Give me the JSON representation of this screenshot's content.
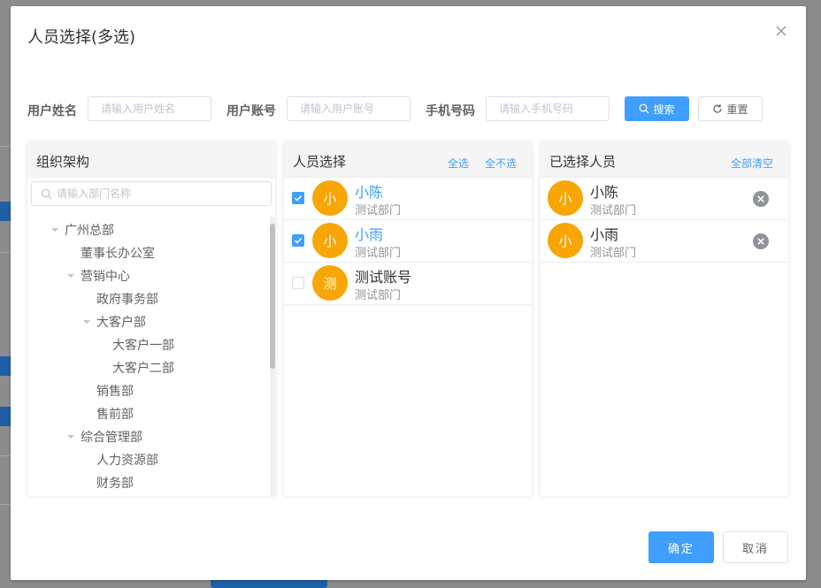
{
  "dialog": {
    "title": "人员选择(多选)"
  },
  "search": {
    "name_label": "用户姓名",
    "name_placeholder": "请输入用户姓名",
    "account_label": "用户账号",
    "account_placeholder": "请输入用户账号",
    "phone_label": "手机号码",
    "phone_placeholder": "请输入手机号码",
    "search_button": "搜索",
    "reset_button": "重置"
  },
  "org_panel": {
    "title": "组织架构",
    "search_placeholder": "请输入部门名称",
    "tree": [
      {
        "label": "广州总部",
        "expanded": true
      },
      {
        "label": "董事长办公室"
      },
      {
        "label": "营销中心",
        "expanded": true
      },
      {
        "label": "政府事务部"
      },
      {
        "label": "大客户部",
        "expanded": true
      },
      {
        "label": "大客户一部"
      },
      {
        "label": "大客户二部"
      },
      {
        "label": "销售部"
      },
      {
        "label": "售前部"
      },
      {
        "label": "综合管理部",
        "expanded": true
      },
      {
        "label": "人力资源部"
      },
      {
        "label": "财务部"
      }
    ]
  },
  "user_panel": {
    "title": "人员选择",
    "select_all": "全选",
    "deselect_all": "全不选",
    "users": [
      {
        "avatar": "小",
        "name": "小陈",
        "dept": "测试部门",
        "checked": true
      },
      {
        "avatar": "小",
        "name": "小雨",
        "dept": "测试部门",
        "checked": true
      },
      {
        "avatar": "测",
        "name": "测试账号",
        "dept": "测试部门",
        "checked": false
      }
    ]
  },
  "selected_panel": {
    "title": "已选择人员",
    "clear_all": "全部清空",
    "users": [
      {
        "avatar": "小",
        "name": "小陈",
        "dept": "测试部门"
      },
      {
        "avatar": "小",
        "name": "小雨",
        "dept": "测试部门"
      }
    ]
  },
  "footer": {
    "confirm": "确定",
    "cancel": "取消"
  },
  "colors": {
    "primary": "#409eff",
    "avatar": "#f7a605"
  }
}
